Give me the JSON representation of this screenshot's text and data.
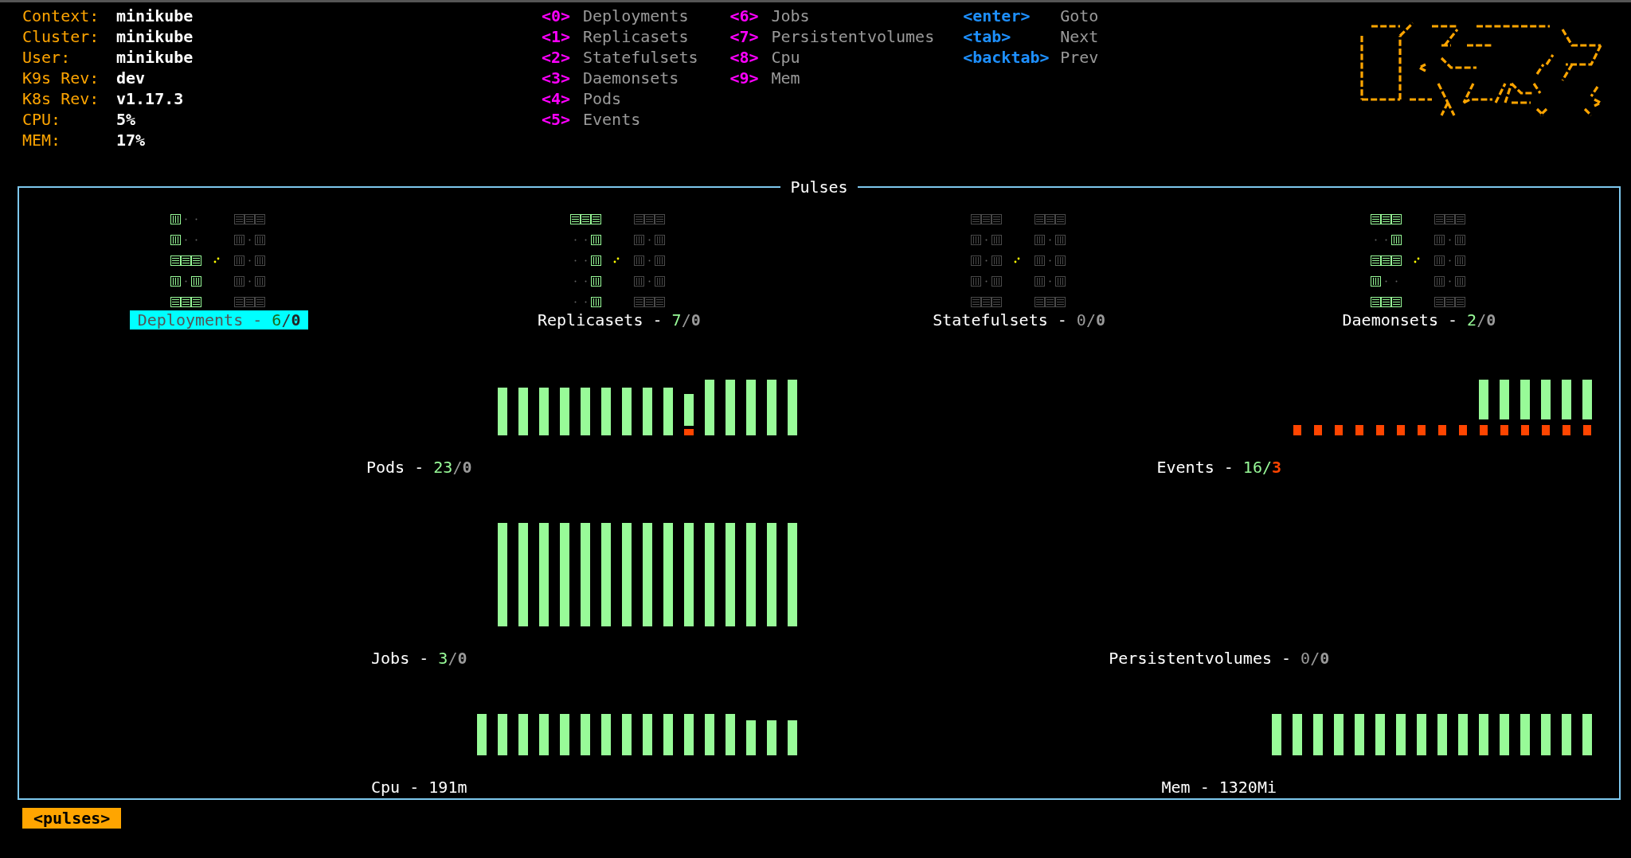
{
  "cluster_info": [
    {
      "label": "Context:",
      "value": "minikube"
    },
    {
      "label": "Cluster:",
      "value": "minikube"
    },
    {
      "label": "User:",
      "value": "minikube"
    },
    {
      "label": "K9s Rev:",
      "value": "dev"
    },
    {
      "label": "K8s Rev:",
      "value": "v1.17.3"
    },
    {
      "label": "CPU:",
      "value": "5%"
    },
    {
      "label": "MEM:",
      "value": "17%"
    }
  ],
  "hotkey_columns": [
    [
      {
        "key": "<0>",
        "action": "Deployments",
        "kind": "view"
      },
      {
        "key": "<1>",
        "action": "Replicasets",
        "kind": "view"
      },
      {
        "key": "<2>",
        "action": "Statefulsets",
        "kind": "view"
      },
      {
        "key": "<3>",
        "action": "Daemonsets",
        "kind": "view"
      },
      {
        "key": "<4>",
        "action": "Pods",
        "kind": "view"
      },
      {
        "key": "<5>",
        "action": "Events",
        "kind": "view"
      }
    ],
    [
      {
        "key": "<6>",
        "action": "Jobs",
        "kind": "view"
      },
      {
        "key": "<7>",
        "action": "Persistentvolumes",
        "kind": "view"
      },
      {
        "key": "<8>",
        "action": "Cpu",
        "kind": "view"
      },
      {
        "key": "<9>",
        "action": "Mem",
        "kind": "view"
      }
    ],
    [
      {
        "key": "<enter>",
        "action": "Goto",
        "kind": "nav"
      },
      {
        "key": "<tab>",
        "action": "Next",
        "kind": "nav"
      },
      {
        "key": "<backtab>",
        "action": "Prev",
        "kind": "nav"
      }
    ]
  ],
  "panel": {
    "title": "Pulses",
    "gauges": [
      {
        "label": "Deployments -",
        "ok": "6",
        "sep": "/",
        "fail": "0",
        "ok_active": true,
        "fail_alert": false,
        "selected": true
      },
      {
        "label": "Replicasets -",
        "ok": "7",
        "sep": "/",
        "fail": "0",
        "ok_active": true,
        "fail_alert": false,
        "selected": false
      },
      {
        "label": "Statefulsets -",
        "ok": "0",
        "sep": "/",
        "fail": "0",
        "ok_active": false,
        "fail_alert": false,
        "selected": false
      },
      {
        "label": "Daemonsets -",
        "ok": "2",
        "sep": "/",
        "fail": "0",
        "ok_active": true,
        "fail_alert": false,
        "selected": false
      }
    ],
    "charts": [
      {
        "kind": "count",
        "label": "Pods -",
        "ok": "23",
        "sep": "/",
        "fail": "0",
        "ok_active": true,
        "fail_alert": false
      },
      {
        "kind": "count",
        "label": "Events -",
        "ok": "16",
        "sep": "/",
        "fail": "3",
        "ok_active": true,
        "fail_alert": true
      },
      {
        "kind": "count",
        "label": "Jobs -",
        "ok": "3",
        "sep": "/",
        "fail": "0",
        "ok_active": true,
        "fail_alert": false
      },
      {
        "kind": "count",
        "label": "Persistentvolumes -",
        "ok": "0",
        "sep": "/",
        "fail": "0",
        "ok_active": false,
        "fail_alert": false
      },
      {
        "kind": "metric",
        "label": "Cpu -",
        "value": "191m"
      },
      {
        "kind": "metric",
        "label": "Mem -",
        "value": "1320Mi"
      }
    ]
  },
  "footer": {
    "crumb": "<pulses>"
  }
}
